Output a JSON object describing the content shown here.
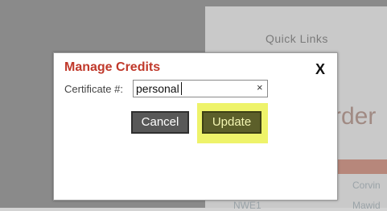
{
  "background": {
    "header_text": "Quick Links",
    "title_partial": "rder",
    "row1_right": "Corvin",
    "row2_left": "NWE1",
    "row2_right": "Mawid"
  },
  "dialog": {
    "title": "Manage Credits",
    "close_label": "X",
    "certificate_label": "Certificate #:",
    "certificate_value": "personal",
    "clear_label": "×",
    "cancel_label": "Cancel",
    "update_label": "Update"
  },
  "colors": {
    "title_red": "#c0392b",
    "highlight_yellow": "#eef36a",
    "update_button": "#5c5f2a",
    "cancel_button": "#585858"
  }
}
